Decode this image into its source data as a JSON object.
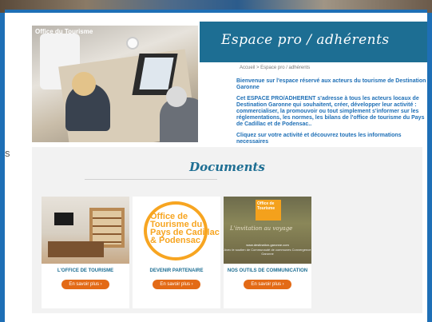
{
  "hero": {
    "logo_text": "Office du Tourisme"
  },
  "banner": {
    "title": "Espace pro / adhérents"
  },
  "breadcrumb": "Accueil  >  Espace pro / adhérents",
  "intro": {
    "p1": "Bienvenue sur l'espace réservé aux acteurs du tourisme de Destination Garonne",
    "p2": "Cet ESPACE PRO/ADHERENT s'adresse à tous les acteurs locaux de Destination Garonne qui souhaitent, créer, développer leur activité : commercialiser, la promouvoir ou tout simplement s'informer sur les réglementations, les normes, les bilans de l'office de tourisme du Pays de Cadillac et de Podensac..",
    "p3": "Cliquez sur votre activité et découvrez toutes les informations necessaires"
  },
  "left_cut_text": "s",
  "documents": {
    "title": "Documents",
    "cards": [
      {
        "label": "L'OFFICE DE TOURISME",
        "button": "En savoir plus ›"
      },
      {
        "label": "DEVENIR PARTENAIRE",
        "button": "En savoir plus ›",
        "logo_text": "Office de Tourisme du Pays de Cadillac & Podensac"
      },
      {
        "label": "NOS OUTILS DE COMMUNICATION",
        "button": "En savoir plus ›",
        "tag_text": "Office de Tourisme",
        "tagline": "L'invitation au voyage",
        "url": "www.destination-garonne.com",
        "sub": "Avec le soutien de Communauté de communes Convergence Garonne"
      }
    ]
  },
  "colors": {
    "page_blue": "#1e6fb6",
    "banner_teal": "#1d6e93",
    "button_orange": "#e36a16",
    "logo_orange": "#f7a521"
  }
}
